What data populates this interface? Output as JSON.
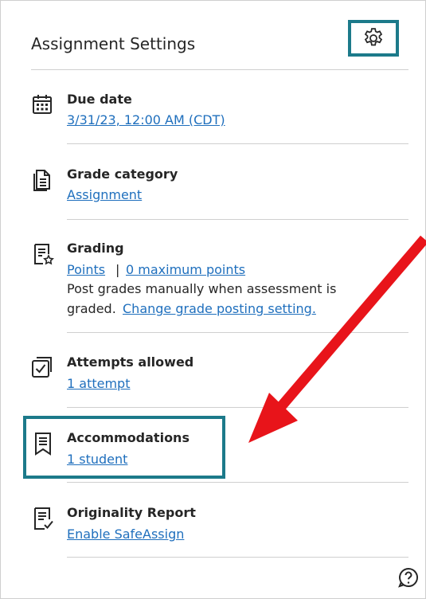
{
  "panel": {
    "title": "Assignment Settings"
  },
  "items": [
    {
      "id": "due-date",
      "label": "Due date",
      "link": "3/31/23, 12:00 AM (CDT)"
    },
    {
      "id": "grade-category",
      "label": "Grade category",
      "link": "Assignment"
    },
    {
      "id": "grading",
      "label": "Grading",
      "link_points": "Points",
      "separator": "|",
      "link_max": "0 maximum points",
      "text_line1": "Post grades manually when assessment is",
      "text_line2": "graded.",
      "link_change": "Change grade posting setting."
    },
    {
      "id": "attempts",
      "label": "Attempts allowed",
      "link": "1 attempt"
    },
    {
      "id": "accommodations",
      "label": "Accommodations",
      "link": "1 student"
    },
    {
      "id": "originality",
      "label": "Originality Report",
      "link": "Enable SafeAssign"
    }
  ],
  "icons": {
    "settings": "gear-icon",
    "due_date": "calendar-icon",
    "grade_category": "document-icon",
    "grading": "grading-icon",
    "attempts": "attempts-checkbox-icon",
    "accommodations": "bookmark-icon",
    "originality": "originality-icon",
    "help": "help-icon"
  },
  "colors": {
    "highlight": "#1c7a8a",
    "link": "#1f6fbd",
    "arrow": "#e8141a"
  }
}
